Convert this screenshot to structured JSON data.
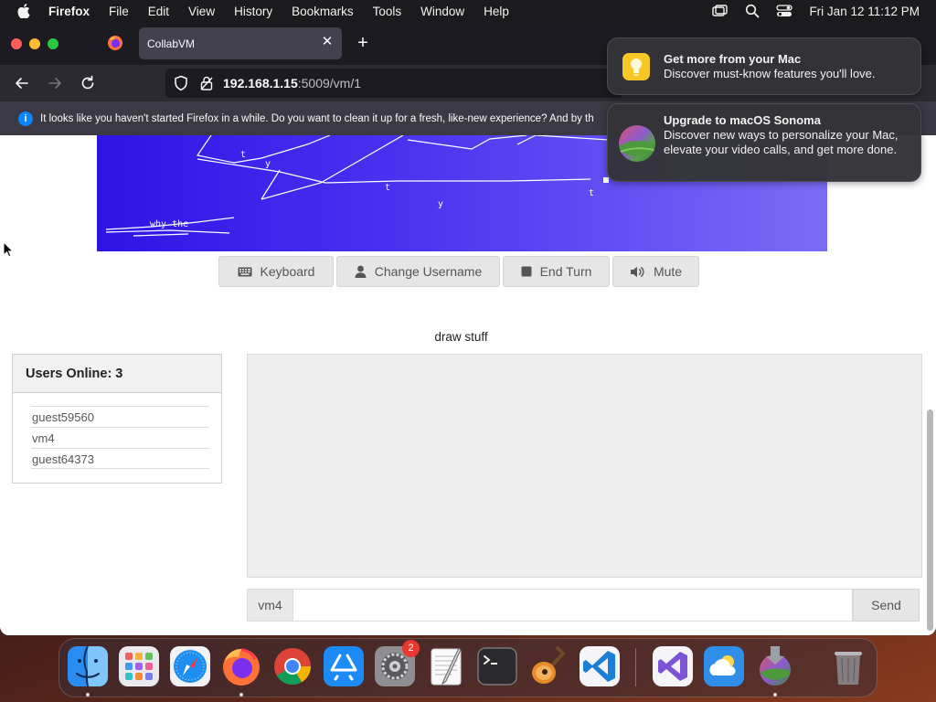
{
  "menubar": {
    "apple_icon": "apple-logo-icon",
    "items": [
      "Firefox",
      "File",
      "Edit",
      "View",
      "History",
      "Bookmarks",
      "Tools",
      "Window",
      "Help"
    ],
    "clock": "Fri Jan 12  11:12 PM",
    "status_icons": [
      "screen-mirroring-icon",
      "spotlight-search-icon",
      "control-center-icon"
    ]
  },
  "browser": {
    "tab_title": "CollabVM",
    "url_host": "192.168.1.15",
    "url_path": ":5009/vm/1",
    "infobar_text": "It looks like you haven't started Firefox in a while. Do you want to clean it up for a fresh, like-new experience? And by th"
  },
  "vm_screen": {
    "scribble_labels": [
      "t",
      "y",
      "t",
      "y",
      "t",
      "why the"
    ]
  },
  "vm_buttons": [
    {
      "label": "Keyboard",
      "icon": "keyboard-icon"
    },
    {
      "label": "Change Username",
      "icon": "user-icon"
    },
    {
      "label": "End Turn",
      "icon": "stop-icon"
    },
    {
      "label": "Mute",
      "icon": "speaker-icon"
    }
  ],
  "motd": "draw stuff",
  "users": {
    "title": "Users Online: 3",
    "list": [
      "guest59560",
      "vm4",
      "guest64373"
    ]
  },
  "chat": {
    "username": "vm4",
    "input_value": "",
    "send_label": "Send"
  },
  "notifications": [
    {
      "title": "Get more from your Mac",
      "body": "Discover must-know features you'll love.",
      "icon": "tips-lightbulb-icon"
    },
    {
      "title": "Upgrade to macOS Sonoma",
      "body": "Discover new ways to personalize your Mac, elevate your video calls, and get more done.",
      "icon": "macos-sonoma-icon"
    }
  ],
  "dock": {
    "apps": [
      "Finder",
      "Launchpad",
      "Safari",
      "Firefox",
      "Chrome",
      "App Store",
      "System Settings",
      "TextEdit",
      "Terminal",
      "GarageBand",
      "Visual Studio Code",
      "Visual Studio",
      "Weather",
      "macOS Sonoma Installer",
      "Trash"
    ],
    "system_settings_badge": "2"
  }
}
